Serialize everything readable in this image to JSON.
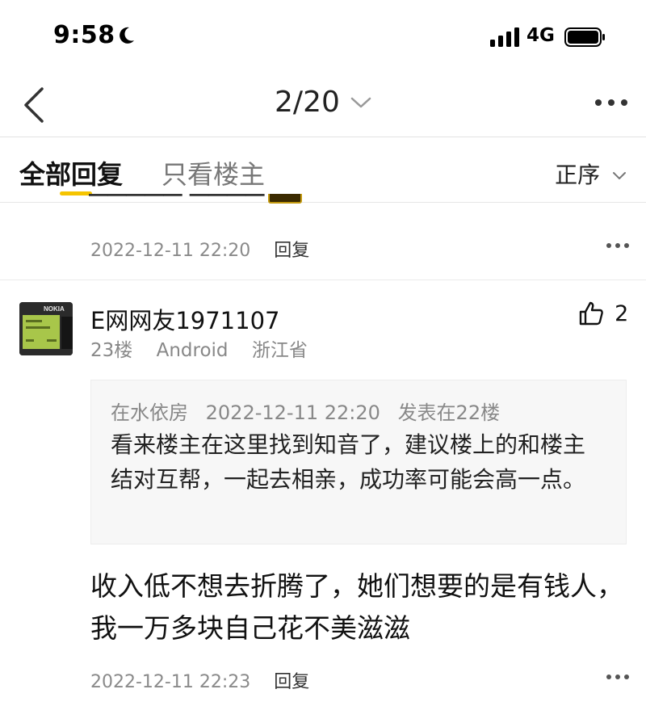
{
  "status_bar": {
    "time": "9:58",
    "network": "4G",
    "icons": [
      "moon-icon",
      "signal-icon",
      "battery-icon"
    ]
  },
  "nav": {
    "page_indicator": "2/20",
    "icons": [
      "back-chevron-icon",
      "chevron-down-icon",
      "more-icon"
    ]
  },
  "tabs": {
    "all_replies": "全部回复",
    "owner_only": "只看楼主",
    "sort": "正序",
    "accent_color": "#f5c400"
  },
  "previous_post": {
    "timestamp": "2022-12-11 22:20",
    "reply_label": "回复"
  },
  "post": {
    "username": "E网网友1971107",
    "floor": "23楼",
    "device": "Android",
    "location": "浙江省",
    "likes": "2",
    "avatar_brand": "NOKIA",
    "quote": {
      "author": "在水依房",
      "timestamp": "2022-12-11 22:20",
      "floor_ref": "发表在22楼",
      "text": "看来楼主在这里找到知音了，建议楼上的和楼主结对互帮，一起去相亲，成功率可能会高一点。"
    },
    "content": "收入低不想去折腾了，她们想要的是有钱人，我一万多块自己花不美滋滋",
    "timestamp": "2022-12-11 22:23",
    "reply_label": "回复"
  }
}
